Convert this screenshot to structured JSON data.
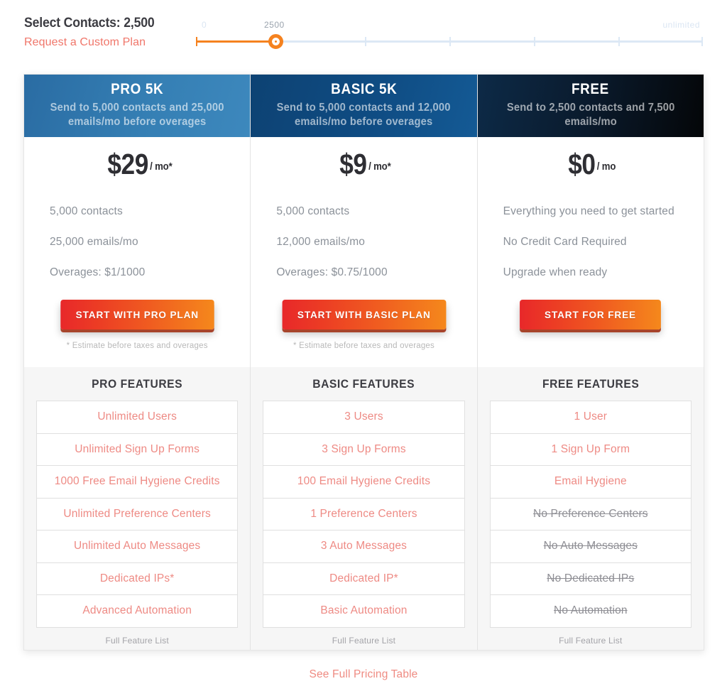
{
  "slider": {
    "label": "Select Contacts: 2,500",
    "custom_plan_link": "Request a Custom Plan",
    "min_label": "0",
    "value_label": "2500",
    "max_label": "unlimited",
    "value": 2500,
    "fill_percent": 15.7,
    "accent_color": "#f5821f",
    "track_color": "#dce8f5"
  },
  "plans": [
    {
      "id": "pro",
      "title": "PRO 5K",
      "subtitle": "Send to 5,000 contacts and 25,000 emails/mo before overages",
      "price_amount": "$29",
      "price_period": "/ mo*",
      "bullets": [
        "5,000 contacts",
        "25,000 emails/mo",
        "Overages: $1/1000"
      ],
      "cta_label": "START WITH PRO PLAN",
      "cta_note": "* Estimate before taxes and overages",
      "features_title": "PRO FEATURES",
      "features": [
        {
          "label": "Unlimited Users",
          "disabled": false
        },
        {
          "label": "Unlimited Sign Up Forms",
          "disabled": false
        },
        {
          "label": "1000 Free Email Hygiene Credits",
          "disabled": false
        },
        {
          "label": "Unlimited Preference Centers",
          "disabled": false
        },
        {
          "label": "Unlimited Auto Messages",
          "disabled": false
        },
        {
          "label": "Dedicated IPs*",
          "disabled": false
        },
        {
          "label": "Advanced Automation",
          "disabled": false
        }
      ],
      "full_list_link": "Full Feature List",
      "header_gradient": "#357fb4"
    },
    {
      "id": "basic",
      "title": "BASIC 5K",
      "subtitle": "Send to 5,000 contacts and 12,000 emails/mo before overages",
      "price_amount": "$9",
      "price_period": "/ mo*",
      "bullets": [
        "5,000 contacts",
        "12,000 emails/mo",
        "Overages: $0.75/1000"
      ],
      "cta_label": "START WITH BASIC PLAN",
      "cta_note": "* Estimate before taxes and overages",
      "features_title": "BASIC FEATURES",
      "features": [
        {
          "label": "3 Users",
          "disabled": false
        },
        {
          "label": "3 Sign Up Forms",
          "disabled": false
        },
        {
          "label": "100 Email Hygiene Credits",
          "disabled": false
        },
        {
          "label": "1 Preference Centers",
          "disabled": false
        },
        {
          "label": "3 Auto Messages",
          "disabled": false
        },
        {
          "label": "Dedicated IP*",
          "disabled": false
        },
        {
          "label": "Basic Automation",
          "disabled": false
        }
      ],
      "full_list_link": "Full Feature List",
      "header_gradient": "#0f4c83"
    },
    {
      "id": "free",
      "title": "FREE",
      "subtitle": "Send to 2,500 contacts and 7,500 emails/mo",
      "price_amount": "$0",
      "price_period": "/ mo",
      "bullets": [
        "Everything you need to get started",
        "No Credit Card Required",
        "Upgrade when ready"
      ],
      "cta_label": "START FOR FREE",
      "cta_note": "",
      "features_title": "FREE FEATURES",
      "features": [
        {
          "label": "1 User",
          "disabled": false
        },
        {
          "label": "1 Sign Up Form",
          "disabled": false
        },
        {
          "label": "Email Hygiene",
          "disabled": false
        },
        {
          "label": "No Preference Centers",
          "disabled": true
        },
        {
          "label": "No Auto Messages",
          "disabled": true
        },
        {
          "label": "No Dedicated IPs",
          "disabled": true
        },
        {
          "label": "No Automation",
          "disabled": true
        }
      ],
      "full_list_link": "Full Feature List",
      "header_gradient": "#0a1a2c"
    }
  ],
  "footer": {
    "link": "See Full Pricing Table",
    "link_color": "#ef8b82"
  }
}
